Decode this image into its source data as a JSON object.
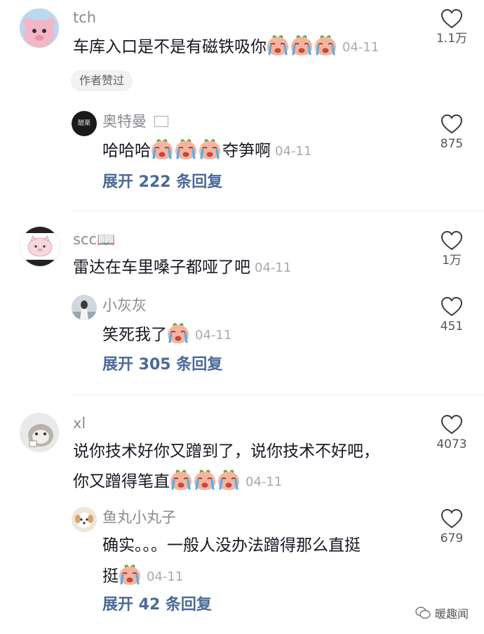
{
  "comments": [
    {
      "user": "tch",
      "text": "车库入口是不是有磁铁吸你",
      "date": "04-11",
      "likes": "1.1万",
      "author_badge": "作者赞过",
      "reply": {
        "user": "奥特曼",
        "text_before": "哈哈哈",
        "text_after": "夺笋啊",
        "date": "04-11",
        "likes": "875"
      },
      "expand": "展开 222 条回复"
    },
    {
      "user": "scc📖",
      "text": "雷达在车里嗓子都哑了吧",
      "date": "04-11",
      "likes": "1万",
      "reply": {
        "user": "小灰灰",
        "text_before": "笑死我了",
        "date": "04-11",
        "likes": "451"
      },
      "expand": "展开 305 条回复"
    },
    {
      "user": "xl",
      "text_line1": "说你技术好你又蹭到了，说你技术不好吧，",
      "text_line2": "你又蹭得笔直",
      "date": "04-11",
      "likes": "4073",
      "reply": {
        "user": "鱼丸小丸子",
        "text_line1": "确实。。。一般人没办法蹭得那么直挺",
        "text_line2": "挺",
        "date": "04-11",
        "likes": "679"
      },
      "expand": "展开 42 条回复"
    }
  ],
  "avatar_labels": {
    "ultraman": "醋栗"
  },
  "watermark": "暖趣闻",
  "colors": {
    "link": "#4a6a98",
    "username": "#8a8b91",
    "date": "#a8a9ad"
  }
}
